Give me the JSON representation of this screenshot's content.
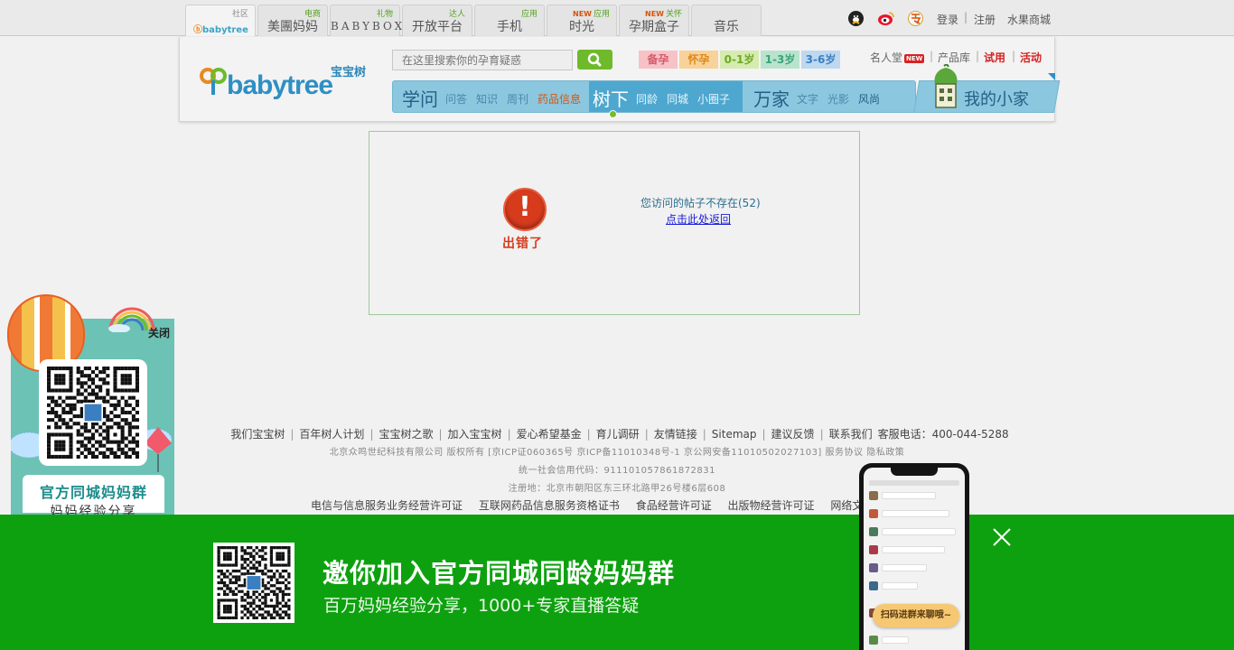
{
  "topbar": {
    "tabs": [
      {
        "label": "",
        "tag": "社区",
        "logo": "babytree",
        "active": true
      },
      {
        "label": "美團妈妈",
        "tag": "电商"
      },
      {
        "label": "BABYBOX",
        "tag": "礼物"
      },
      {
        "label": "开放平台",
        "tag": "达人"
      },
      {
        "label": "手机",
        "tag": "应用"
      },
      {
        "label": "时光",
        "tag": "应用",
        "new": "NEW"
      },
      {
        "label": "孕期盒子",
        "tag": "关怀",
        "new": "NEW"
      },
      {
        "label": "音乐",
        "tag": ""
      }
    ],
    "mini_logo_en": "babytree",
    "icons": [
      "qq-icon",
      "weibo-icon",
      "renren-icon"
    ],
    "login": "登录",
    "separator": "|",
    "register": "注册",
    "mall": "水果商城"
  },
  "header": {
    "logo_cn": "宝宝树",
    "logo_en": "babytree",
    "search_placeholder": "在这里搜索你的孕育疑惑",
    "stages": [
      {
        "label": "备孕",
        "bg": "#f6c2c6",
        "color": "#d85a6a"
      },
      {
        "label": "怀孕",
        "bg": "#f7d29a",
        "color": "#e0881a"
      },
      {
        "label": "0-1岁",
        "bg": "#d6ebb0",
        "color": "#6caa22"
      },
      {
        "label": "1-3岁",
        "bg": "#b9e3cd",
        "color": "#3aa37a"
      },
      {
        "label": "3-6岁",
        "bg": "#bed8ef",
        "color": "#3b7fc0"
      }
    ],
    "right_links": {
      "famous": "名人堂",
      "new_badge": "NEW",
      "products": "产品库",
      "trial": "试用",
      "events": "活动",
      "sep": "|"
    },
    "nav": {
      "group1_title": "学问",
      "group1_items": [
        "问答",
        "知识",
        "周刊",
        "药品信息"
      ],
      "group2_title": "树下",
      "group2_items": [
        "同龄",
        "同城",
        "小圈子"
      ],
      "group3_title": "万家",
      "group3_items": [
        "文字",
        "光影",
        "风尚"
      ],
      "home": "我的小家"
    }
  },
  "error": {
    "icon": "!",
    "caption": "出错了",
    "message": "您访问的帖子不存在(52)",
    "back_link": "点击此处返回"
  },
  "footer": {
    "links": [
      "我们宝宝树",
      "百年树人计划",
      "宝宝树之歌",
      "加入宝宝树",
      "爱心希望基金",
      "育儿调研",
      "友情链接",
      "Sitemap",
      "建议反馈",
      "联系我们"
    ],
    "hotline": "客服电话：400-044-5288",
    "copyright": "北京众鸣世纪科技有限公司 版权所有 [京ICP证060365号 京ICP备11010348号-1 京公网安备11010502027103] 服务协议 隐私政策",
    "credit_code": "统一社会信用代码：911101057861872831",
    "address": "注册地：北京市朝阳区东三环北路甲26号楼6层608",
    "certs": [
      "电信与信息服务业务经营许可证",
      "互联网药品信息服务资格证书",
      "食品经营许可证",
      "出版物经营许可证",
      "网络文"
    ]
  },
  "side_ad": {
    "close": "关闭",
    "title": "官方同城妈妈群",
    "subtitle": "妈妈经验分享"
  },
  "banner": {
    "title": "邀你加入官方同城同龄妈妈群",
    "subtitle": "百万妈妈经验分享，1000+专家直播答疑",
    "phone_pill": "扫码进群来聊哦~",
    "bg": "#0ea10f"
  }
}
